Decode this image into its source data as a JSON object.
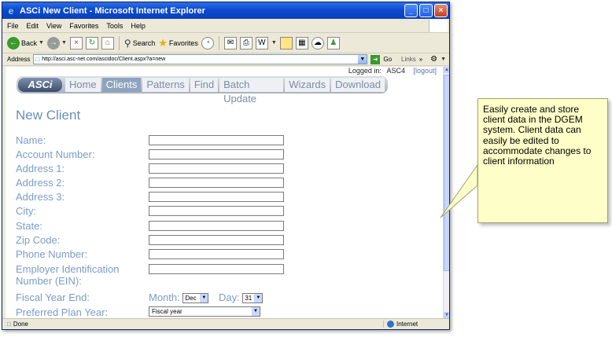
{
  "window": {
    "title": "ASCi New Client - Microsoft Internet Explorer",
    "buttons": [
      "_",
      "□",
      "×"
    ]
  },
  "menu": [
    "File",
    "Edit",
    "View",
    "Favorites",
    "Tools",
    "Help"
  ],
  "toolbar": {
    "back": "Back",
    "search": "Search",
    "favorites": "Favorites"
  },
  "address": {
    "label": "Address",
    "url": "http://asci.asc-net.com/ascidoc/Client.aspx?a=new",
    "go": "Go",
    "links": "Links"
  },
  "page": {
    "logged_in_label": "Logged in:",
    "user": "ASC4",
    "logout": "[logout]",
    "logo": "ASCi",
    "nav": [
      "Home",
      "Clients",
      "Patterns",
      "Find",
      "Batch Update",
      "Wizards",
      "Download"
    ],
    "nav_active": "Clients",
    "title": "New Client",
    "fields": [
      {
        "label": "Name:"
      },
      {
        "label": "Account Number:"
      },
      {
        "label": "Address 1:"
      },
      {
        "label": "Address 2:"
      },
      {
        "label": "Address 3:"
      },
      {
        "label": "City:"
      },
      {
        "label": "State:"
      },
      {
        "label": "Zip Code:"
      },
      {
        "label": "Phone Number:"
      },
      {
        "label": "Employer Identification Number (EIN):"
      }
    ],
    "fiscal": {
      "label": "Fiscal Year End:",
      "month_label": "Month:",
      "month_value": "Dec",
      "day_label": "Day:",
      "day_value": "31"
    },
    "plan": {
      "label": "Preferred Plan Year:",
      "value": "Fiscal year"
    }
  },
  "status": {
    "text": "Done",
    "zone": "Internet"
  },
  "callout": {
    "text": "Easily create and store client data in the DGEM system. Client data can easily be edited to accommodate changes to client information"
  }
}
